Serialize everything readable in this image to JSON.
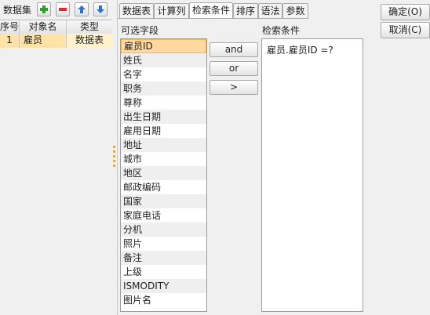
{
  "dataset": {
    "title": "数据集",
    "columns": [
      "序号",
      "对象名",
      "类型"
    ],
    "rows": [
      {
        "index": "1",
        "name": "雇员",
        "type": "数据表"
      }
    ]
  },
  "toolbar_icons": [
    "add-icon",
    "remove-icon",
    "move-up-icon",
    "move-down-icon"
  ],
  "tabs": [
    "数据表",
    "计算列",
    "检索条件",
    "排序",
    "语法",
    "参数"
  ],
  "active_tab": "检索条件",
  "available_fields": {
    "label": "可选字段",
    "items": [
      "雇员ID",
      "姓氏",
      "名字",
      "职务",
      "尊称",
      "出生日期",
      "雇用日期",
      "地址",
      "城市",
      "地区",
      "邮政编码",
      "国家",
      "家庭电话",
      "分机",
      "照片",
      "备注",
      "上级",
      "ISMODITY",
      "图片名"
    ],
    "selected": "雇员ID"
  },
  "operators": {
    "and": "and",
    "or": "or",
    "arrow": ">"
  },
  "condition": {
    "label": "检索条件",
    "text": "雇员.雇员ID =?"
  },
  "dialog_buttons": {
    "ok": "确定(O)",
    "cancel": "取消(C)"
  },
  "colors": {
    "selected_row": "#ffe3a6",
    "selected_field": "#ffd9a0",
    "add": "#2e9e2e",
    "remove": "#d83030",
    "arrow": "#2f6fd0"
  }
}
